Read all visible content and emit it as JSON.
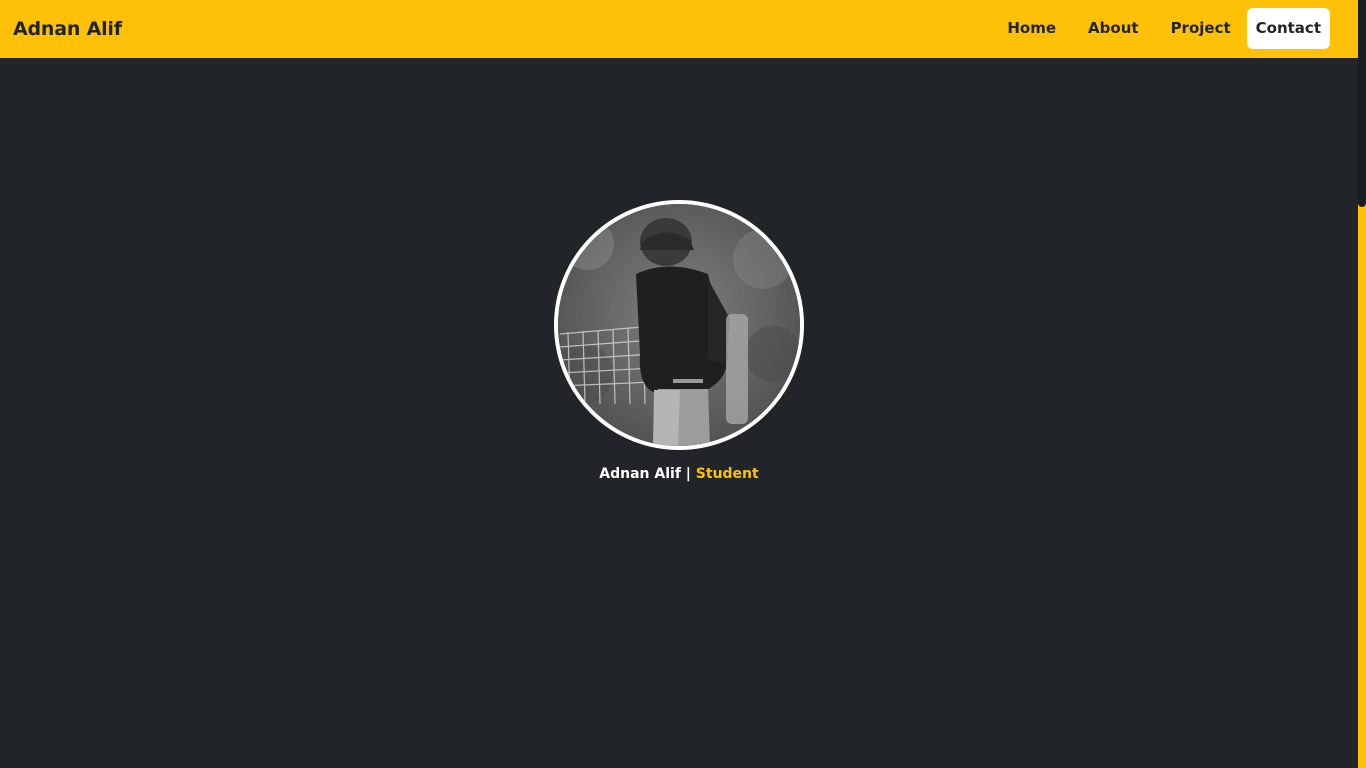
{
  "navbar": {
    "brand": "Adnan Alif",
    "links": [
      {
        "label": "Home"
      },
      {
        "label": "About"
      },
      {
        "label": "Project"
      },
      {
        "label": "Contact"
      }
    ]
  },
  "hero": {
    "name": "Adnan Alif",
    "separator": "|",
    "role": "Student"
  },
  "colors": {
    "accent": "#ffc107",
    "background": "#212428",
    "text": "#ffffff"
  },
  "icons": {
    "avatar": "profile-photo"
  }
}
